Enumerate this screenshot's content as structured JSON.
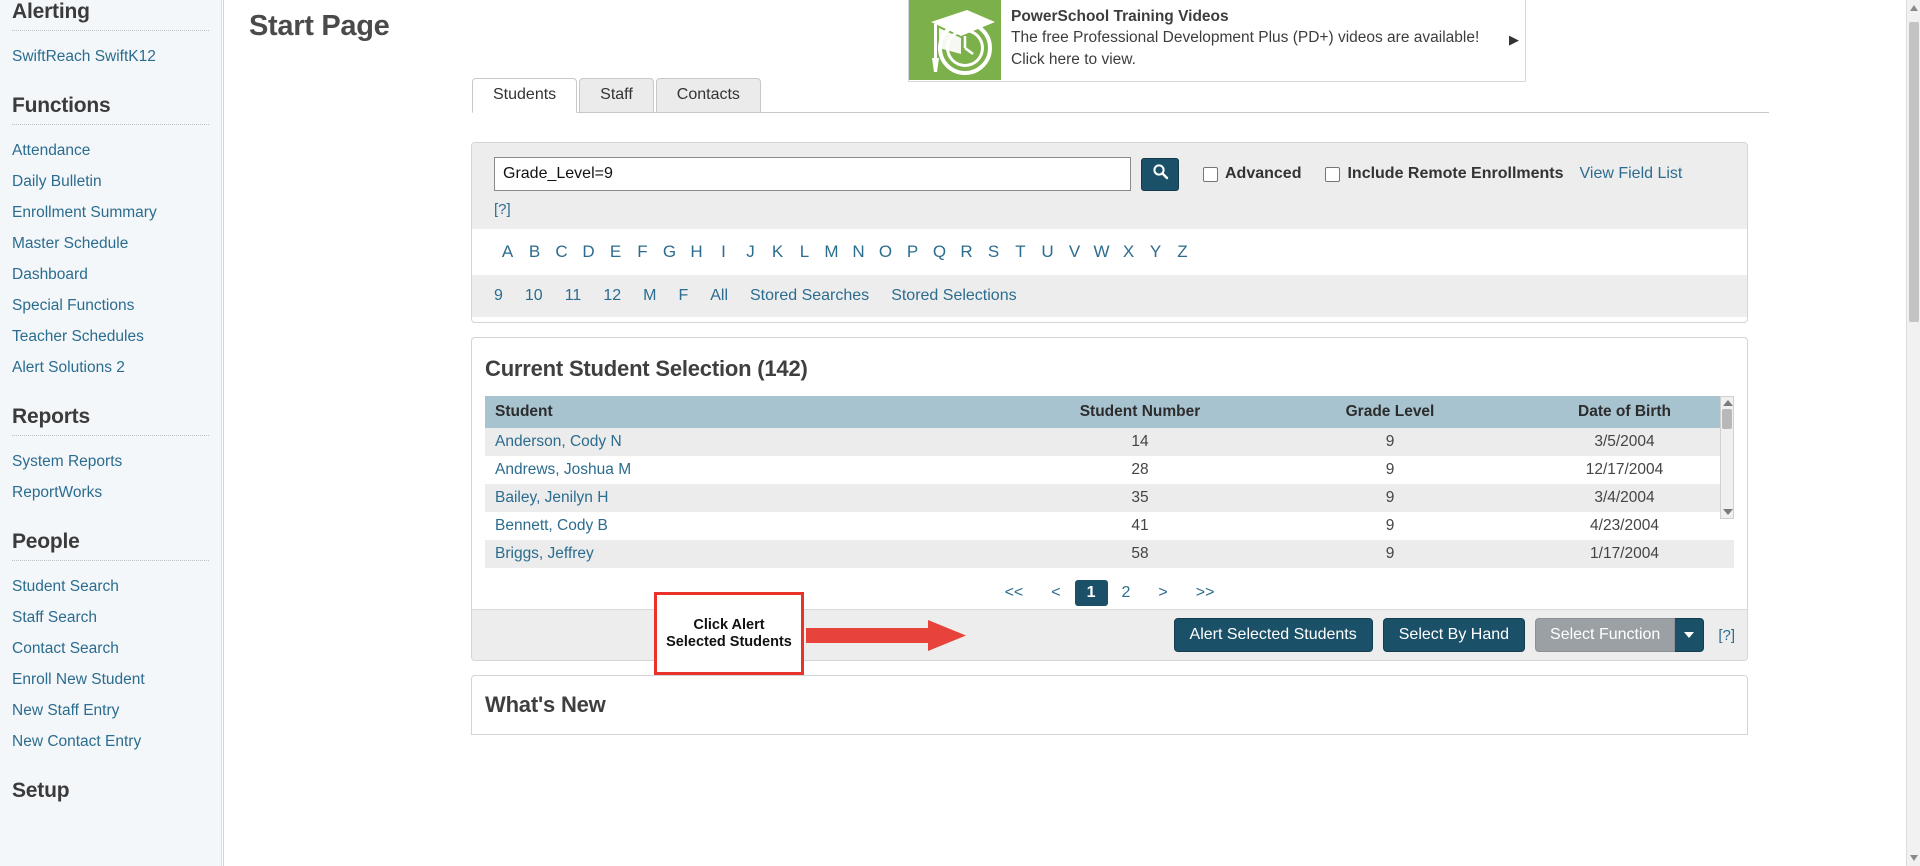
{
  "sidebar": {
    "sections": [
      {
        "heading": "Alerting",
        "items": [
          {
            "label": "SwiftReach SwiftK12"
          }
        ]
      },
      {
        "heading": "Functions",
        "items": [
          {
            "label": "Attendance"
          },
          {
            "label": "Daily Bulletin"
          },
          {
            "label": "Enrollment Summary"
          },
          {
            "label": "Master Schedule"
          },
          {
            "label": "Dashboard"
          },
          {
            "label": "Special Functions"
          },
          {
            "label": "Teacher Schedules"
          },
          {
            "label": "Alert Solutions 2"
          }
        ]
      },
      {
        "heading": "Reports",
        "items": [
          {
            "label": "System Reports"
          },
          {
            "label": "ReportWorks"
          }
        ]
      },
      {
        "heading": "People",
        "items": [
          {
            "label": "Student Search"
          },
          {
            "label": "Staff Search"
          },
          {
            "label": "Contact Search"
          },
          {
            "label": "Enroll New Student"
          },
          {
            "label": "New Staff Entry"
          },
          {
            "label": "New Contact Entry"
          }
        ]
      },
      {
        "heading": "Setup",
        "items": []
      }
    ]
  },
  "header": {
    "page_title": "Start Page"
  },
  "banner": {
    "title": "PowerSchool Training Videos",
    "body": "The free Professional Development Plus (PD+) videos are available! Click here to view.",
    "icon": "graduation-cap-clock-icon",
    "next_arrow": "▶",
    "icon_bg": "#7cb04b"
  },
  "tabs": [
    {
      "label": "Students",
      "active": true
    },
    {
      "label": "Staff",
      "active": false
    },
    {
      "label": "Contacts",
      "active": false
    }
  ],
  "search": {
    "value": "Grade_Level=9",
    "placeholder": "",
    "button_icon": "search-icon",
    "help_link": "[?]",
    "advanced_label": "Advanced",
    "advanced_checked": false,
    "remote_label": "Include Remote Enrollments",
    "remote_checked": false,
    "view_field_list": "View Field List",
    "alphabet": [
      "A",
      "B",
      "C",
      "D",
      "E",
      "F",
      "G",
      "H",
      "I",
      "J",
      "K",
      "L",
      "M",
      "N",
      "O",
      "P",
      "Q",
      "R",
      "S",
      "T",
      "U",
      "V",
      "W",
      "X",
      "Y",
      "Z"
    ],
    "quick_filters": [
      "9",
      "10",
      "11",
      "12",
      "M",
      "F",
      "All",
      "Stored Searches",
      "Stored Selections"
    ]
  },
  "selection": {
    "title": "Current Student Selection (142)",
    "count": 142,
    "columns": [
      "Student",
      "Student Number",
      "Grade Level",
      "Date of Birth"
    ],
    "rows": [
      {
        "student": "Anderson, Cody N",
        "number": "14",
        "grade": "9",
        "dob": "3/5/2004"
      },
      {
        "student": "Andrews, Joshua M",
        "number": "28",
        "grade": "9",
        "dob": "12/17/2004"
      },
      {
        "student": "Bailey, Jenilyn H",
        "number": "35",
        "grade": "9",
        "dob": "3/4/2004"
      },
      {
        "student": "Bennett, Cody B",
        "number": "41",
        "grade": "9",
        "dob": "4/23/2004"
      },
      {
        "student": "Briggs, Jeffrey",
        "number": "58",
        "grade": "9",
        "dob": "1/17/2004"
      }
    ],
    "pagination": {
      "first": "<<",
      "prev": "<",
      "pages": [
        "1",
        "2"
      ],
      "current": "1",
      "next": ">",
      "last": ">>"
    },
    "actions": {
      "alert_selected": "Alert Selected Students",
      "select_by_hand": "Select By Hand",
      "select_function": "Select Function",
      "caret": "chevron-down-icon",
      "help": "[?]"
    }
  },
  "whats_new": {
    "title": "What's New"
  },
  "annotation": {
    "callout_line1": "Click Alert",
    "callout_line2": "Selected Students",
    "border_color": "#e8322a",
    "arrow_color": "#e8433a"
  }
}
